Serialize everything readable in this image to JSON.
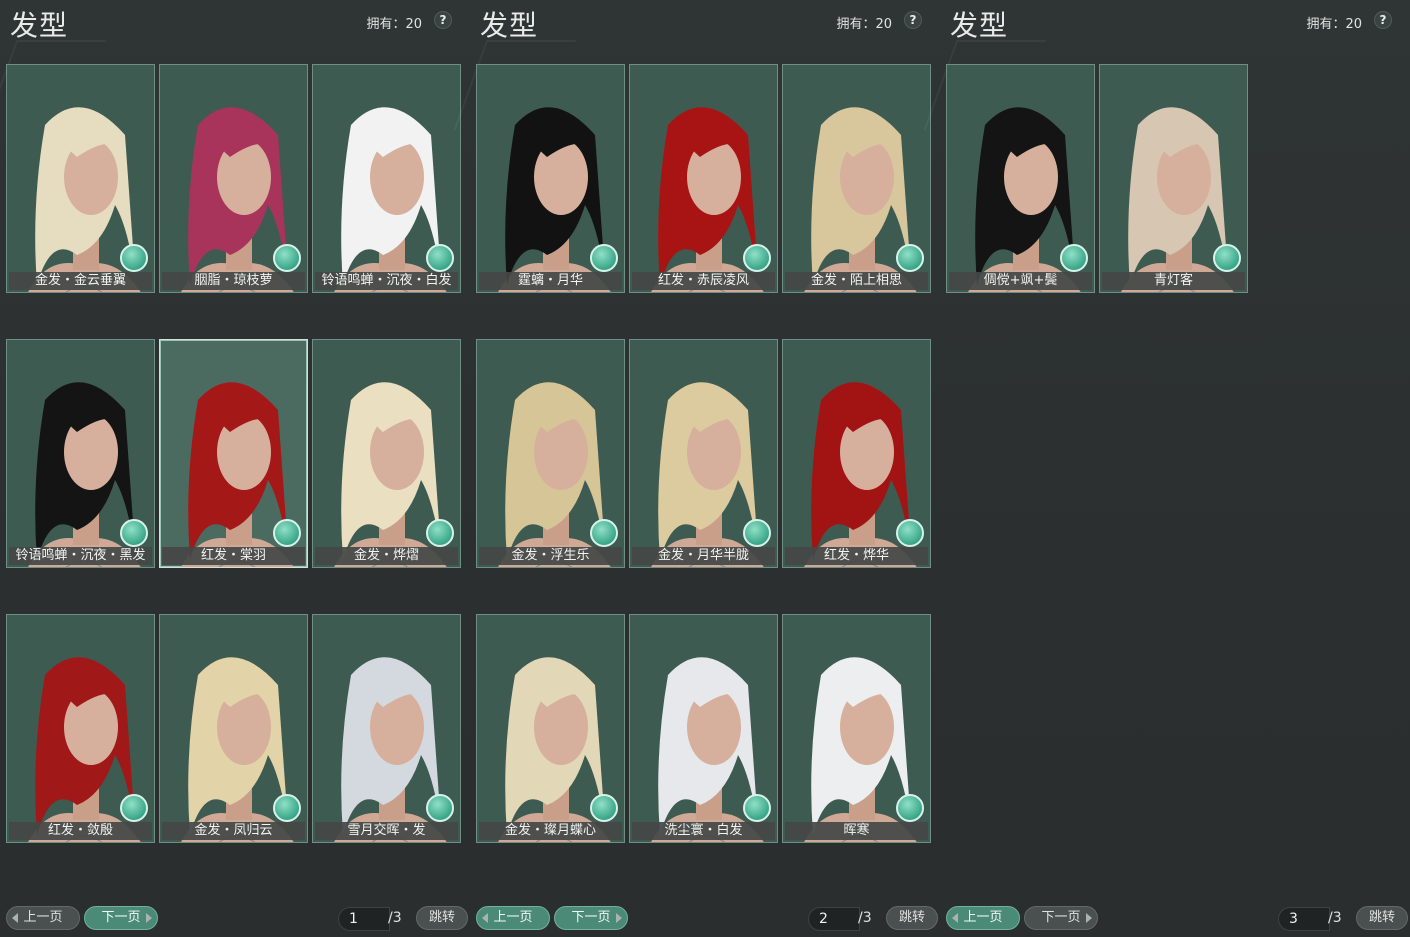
{
  "panels": [
    {
      "title": "发型",
      "owned": "拥有：20",
      "help": "?",
      "cards": [
        {
          "label": "金发・金云垂翼",
          "hair": "#e6dcc0",
          "selected": false
        },
        {
          "label": "胭脂・琼枝萝",
          "hair": "#a8345c",
          "selected": false
        },
        {
          "label": "铃语鸣蝉・沉夜・白发",
          "hair": "#f2f2f2",
          "selected": false
        },
        {
          "label": "铃语鸣蝉・沉夜・黑发",
          "hair": "#141414",
          "selected": false
        },
        {
          "label": "红发・棠羽",
          "hair": "#a51818",
          "selected": true
        },
        {
          "label": "金发・烨熠",
          "hair": "#eadfc0",
          "selected": false
        },
        {
          "label": "红发・敛殷",
          "hair": "#a01818",
          "selected": false
        },
        {
          "label": "金发・凤归云",
          "hair": "#e2d3a8",
          "selected": false
        },
        {
          "label": "雪月交晖・发",
          "hair": "#d4d9df",
          "selected": false
        }
      ],
      "prev": "上一页",
      "next": "下一页",
      "active": "next",
      "page": "1",
      "total": "/3",
      "jump": "跳转"
    },
    {
      "title": "发型",
      "owned": "拥有：20",
      "help": "?",
      "cards": [
        {
          "label": "霆螭・月华",
          "hair": "#121212",
          "selected": false
        },
        {
          "label": "红发・赤辰凌风",
          "hair": "#a81414",
          "selected": false
        },
        {
          "label": "金发・陌上相思",
          "hair": "#d8c79c",
          "selected": false
        },
        {
          "label": "金发・浮生乐",
          "hair": "#d6c596",
          "selected": false
        },
        {
          "label": "金发・月华半胧",
          "hair": "#dccb9e",
          "selected": false
        },
        {
          "label": "红发・烨华",
          "hair": "#a21414",
          "selected": false
        },
        {
          "label": "金发・璨月蝶心",
          "hair": "#e2d7b6",
          "selected": false
        },
        {
          "label": "洗尘寰・白发",
          "hair": "#e6e8ec",
          "selected": false
        },
        {
          "label": "晖寒",
          "hair": "#eceef0",
          "selected": false
        }
      ],
      "prev": "上一页",
      "next": "下一页",
      "active": "both",
      "page": "2",
      "total": "/3",
      "jump": "跳转"
    },
    {
      "title": "发型",
      "owned": "拥有：20",
      "help": "?",
      "cards": [
        {
          "label": "倜傥+飒+鬓",
          "hair": "#141414",
          "selected": false
        },
        {
          "label": "青灯客",
          "hair": "#d6c6b2",
          "selected": false
        }
      ],
      "prev": "上一页",
      "next": "下一页",
      "active": "prev",
      "page": "3",
      "total": "/3",
      "jump": "跳转"
    }
  ],
  "icons": {
    "dye": "brush-dye-icon",
    "help": "question-icon"
  }
}
